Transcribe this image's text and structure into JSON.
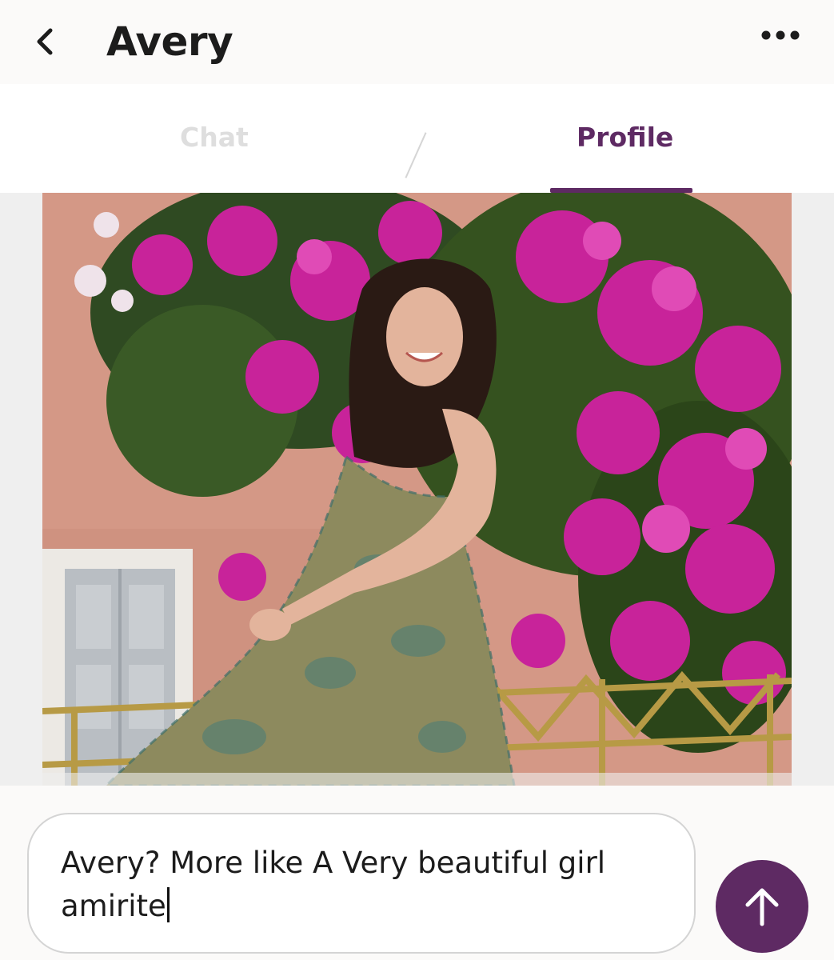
{
  "header": {
    "title": "Avery",
    "back_icon": "chevron-left-icon",
    "more_icon": "more-horizontal-icon"
  },
  "tabs": [
    {
      "label": "Chat",
      "active": false
    },
    {
      "label": "Profile",
      "active": true
    }
  ],
  "profile_photo": {
    "subject": "Woman in patterned dress in front of pink bougainvillea"
  },
  "composer": {
    "message_text": "Avery? More like A Very beautiful girl amirite",
    "send_icon": "arrow-up-icon"
  },
  "colors": {
    "accent": "#5e2a63",
    "inactive_tab": "#dedede",
    "background": "#fbfaf9"
  }
}
